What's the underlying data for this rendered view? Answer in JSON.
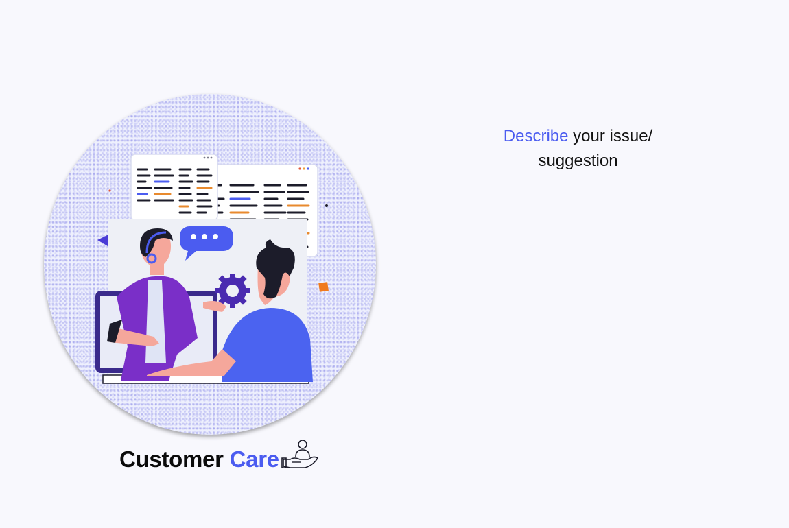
{
  "illustration": {
    "name": "customer-support-illustration"
  },
  "brand": {
    "word1": "Customer",
    "word2": "Care",
    "icon": "hand-person-icon"
  },
  "headline": {
    "accent": "Describe",
    "rest_line1": " your issue/",
    "line2": "suggestion"
  },
  "colors": {
    "background": "#f8f8fd",
    "accent": "#4b5cf0",
    "text": "#111111",
    "purple": "#7a2fc8",
    "blue_shirt": "#4b63f0"
  }
}
